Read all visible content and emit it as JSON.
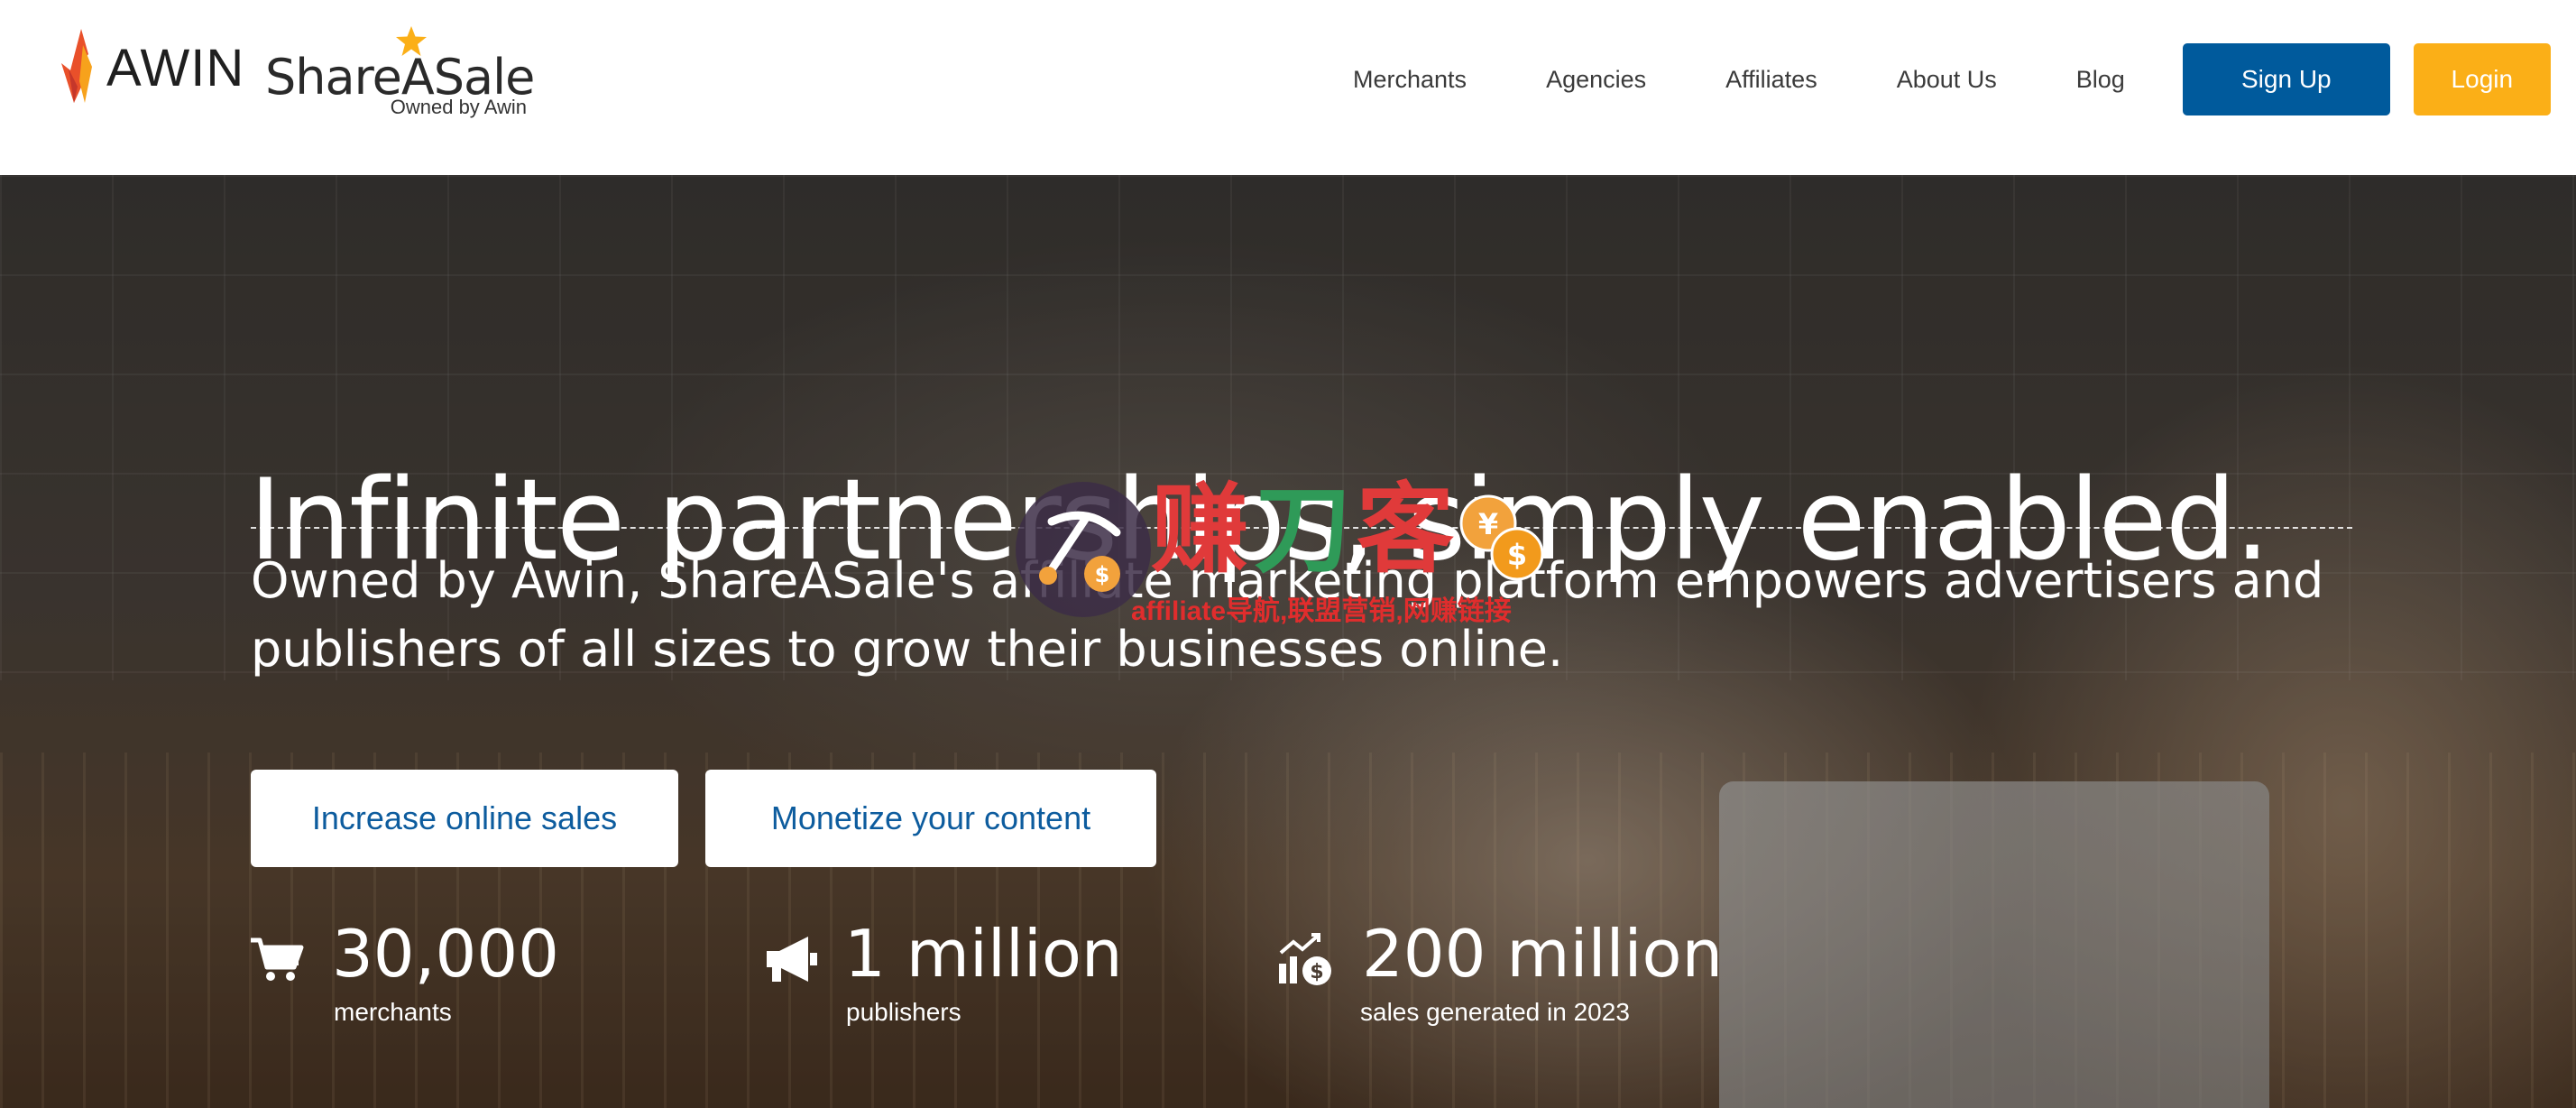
{
  "brand": {
    "awin_name": "AWIN",
    "sas_name": "ShareASale",
    "sas_tagline": "Owned by Awin",
    "awin_color": "#e9502a",
    "star_color": "#fbaf17"
  },
  "nav": {
    "links": [
      {
        "label": "Merchants"
      },
      {
        "label": "Agencies"
      },
      {
        "label": "Affiliates"
      },
      {
        "label": "About Us"
      },
      {
        "label": "Blog"
      }
    ],
    "signup_label": "Sign Up",
    "login_label": "Login",
    "signup_color": "#005a9c",
    "login_color": "#fbaf17"
  },
  "hero": {
    "title": "Infinite partnerships, simply enabled.",
    "subtitle_line1": "Owned by Awin, ShareASale's affiliate marketing platform empowers advertisers and",
    "subtitle_line2": "publishers of all sizes to grow their businesses online.",
    "cta_primary": "Increase online sales",
    "cta_secondary": "Monetize your content",
    "cta_text_color": "#0d5c9e"
  },
  "stats": [
    {
      "icon": "shopping-cart-icon",
      "value": "30,000",
      "label": "merchants"
    },
    {
      "icon": "megaphone-icon",
      "value": "1 million",
      "label": "publishers"
    },
    {
      "icon": "growth-chart-dollar-icon",
      "value": "200 million",
      "label": "sales generated in 2023"
    }
  ],
  "watermark": {
    "glyph1": "赚",
    "glyph2": "刀",
    "glyph3": "客",
    "caption": "affiliate导航,联盟营销,网赚链接"
  }
}
